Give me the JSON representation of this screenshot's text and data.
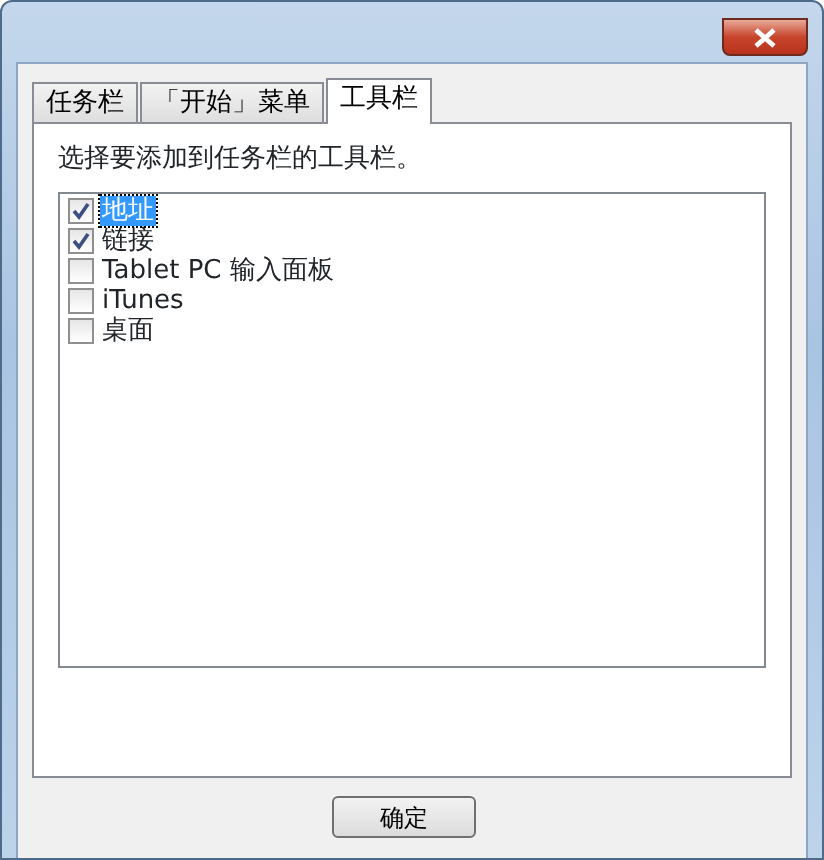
{
  "tabs": [
    {
      "label": "任务栏",
      "selected": false
    },
    {
      "label": "「开始」菜单",
      "selected": false
    },
    {
      "label": "工具栏",
      "selected": true
    }
  ],
  "instruction": "选择要添加到任务栏的工具栏。",
  "toolbars": [
    {
      "label": "地址",
      "checked": true,
      "selected": true
    },
    {
      "label": "链接",
      "checked": true,
      "selected": false
    },
    {
      "label": "Tablet PC 输入面板",
      "checked": false,
      "selected": false
    },
    {
      "label": "iTunes",
      "checked": false,
      "selected": false
    },
    {
      "label": "桌面",
      "checked": false,
      "selected": false
    }
  ],
  "buttons": [
    {
      "label": "确定"
    }
  ]
}
